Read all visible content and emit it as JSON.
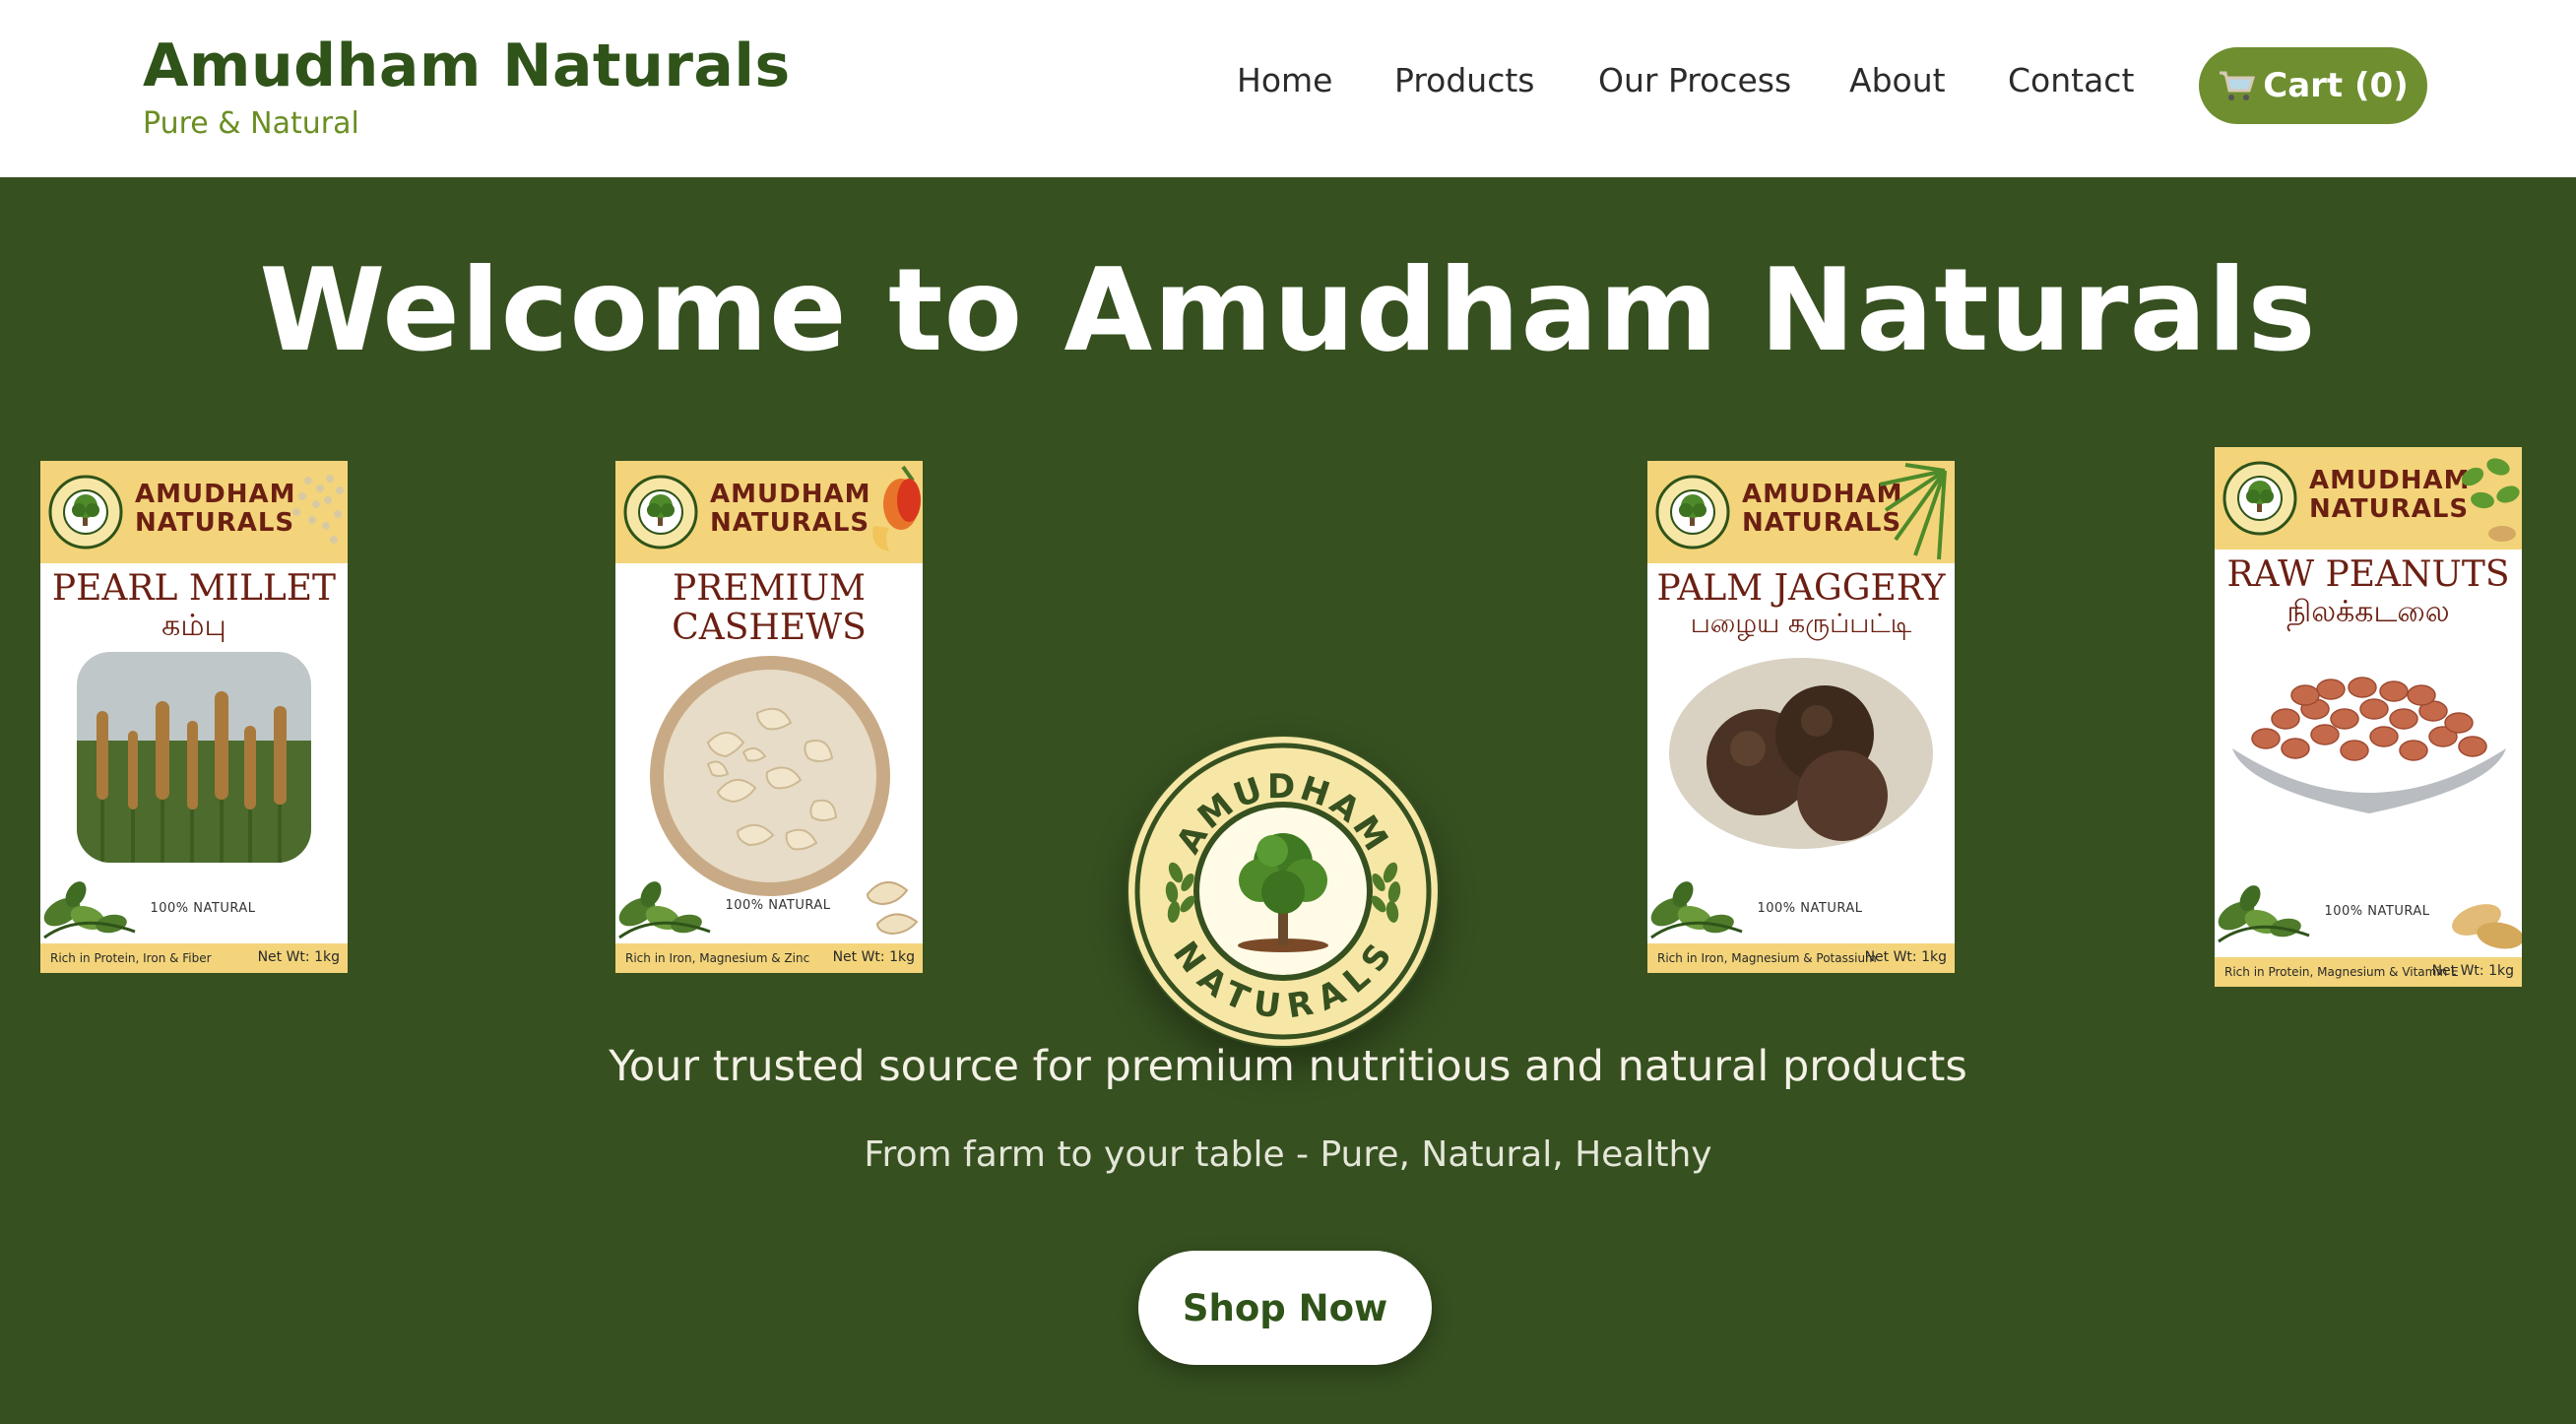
{
  "header": {
    "brand_title": "Amudham Naturals",
    "brand_subtitle": "Pure & Natural",
    "nav": [
      "Home",
      "Products",
      "Our Process",
      "About",
      "Contact"
    ],
    "cart_label": "Cart (0)",
    "cart_icon": "shopping-cart-icon"
  },
  "hero": {
    "title": "Welcome to Amudham Naturals",
    "tagline": "Your trusted source for premium nutritious and natural products",
    "subtagline": "From farm to your table - Pure, Natural, Healthy",
    "shop_button": "Shop Now"
  },
  "emblem": {
    "top_text": "AMUDHAM",
    "bottom_text": "NATURALS"
  },
  "products": [
    {
      "brand_line1": "AMUDHAM",
      "brand_line2": "NATURALS",
      "name": "PEARL MILLET",
      "name_tamil": "கம்பு",
      "natural": "100% NATURAL",
      "nutrition": "Rich in Protein, Iron & Fiber",
      "weight": "Net Wt: 1kg"
    },
    {
      "brand_line1": "AMUDHAM",
      "brand_line2": "NATURALS",
      "name": "PREMIUM",
      "name_line2": "CASHEWS",
      "natural": "100% NATURAL",
      "nutrition": "Rich in Iron, Magnesium & Zinc",
      "weight": "Net Wt: 1kg"
    },
    {
      "brand_line1": "AMUDHAM",
      "brand_line2": "NATURALS",
      "name": "PALM JAGGERY",
      "name_tamil": "பழைய கருப்பட்டி",
      "natural": "100% NATURAL",
      "nutrition": "Rich in Iron, Magnesium & Potassium",
      "weight": "Net Wt: 1kg"
    },
    {
      "brand_line1": "AMUDHAM",
      "brand_line2": "NATURALS",
      "name": "RAW PEANUTS",
      "name_tamil": "நிலக்கடலை",
      "natural": "100% NATURAL",
      "nutrition": "Rich in Protein, Magnesium & Vitamin E",
      "weight": "Net Wt: 1kg"
    }
  ],
  "colors": {
    "brand_green": "#2f5319",
    "hero_bg": "#365020",
    "cart_green": "#6e8e30",
    "label_yellow": "#f3d47a",
    "label_maroon": "#6b1f12"
  }
}
